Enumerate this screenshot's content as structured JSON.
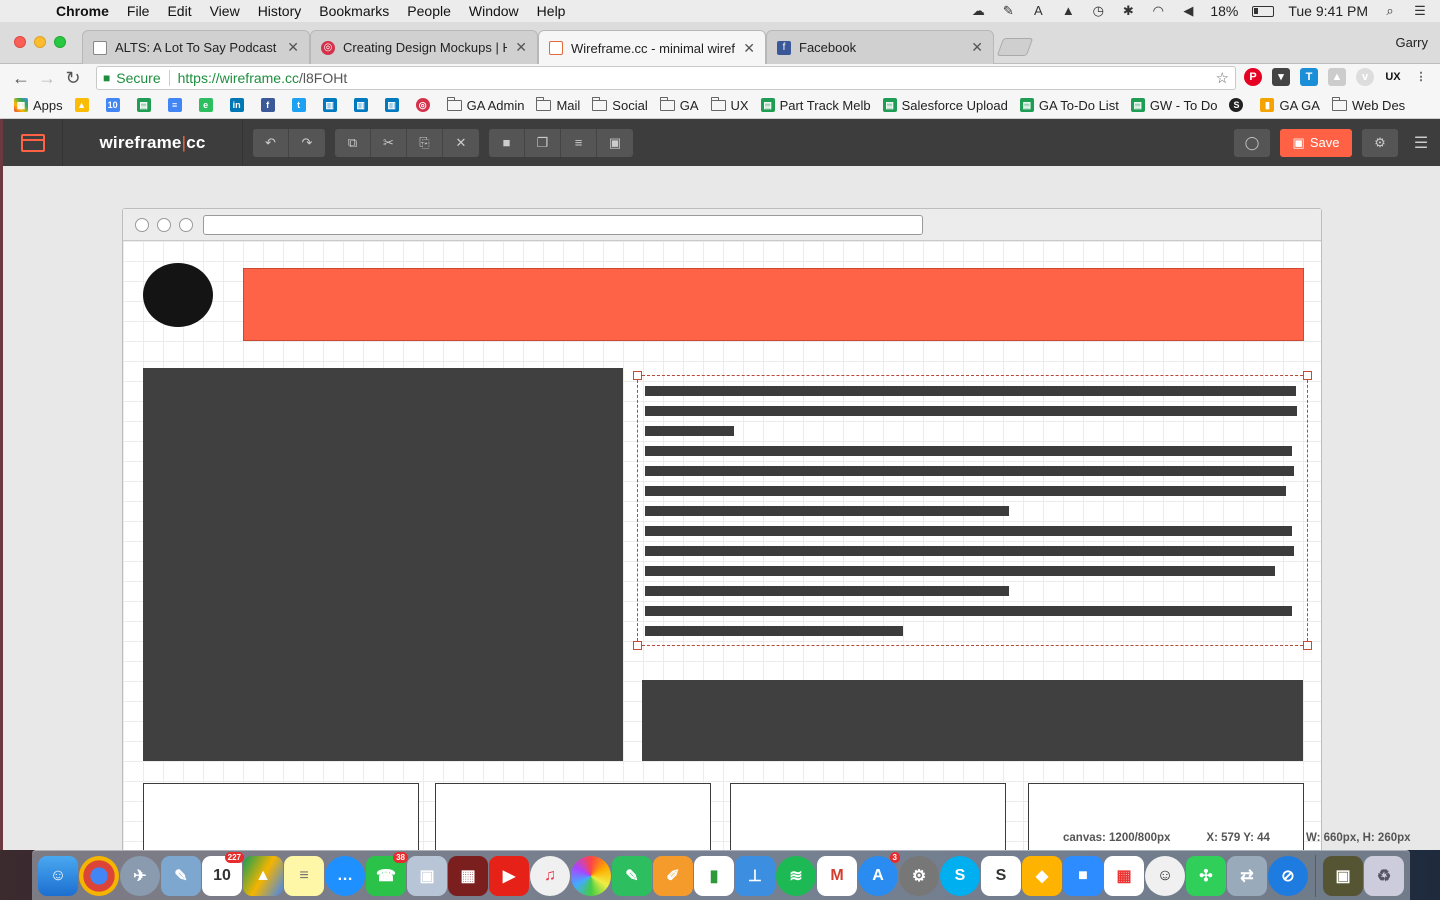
{
  "menubar": {
    "app": "Chrome",
    "items": [
      "File",
      "Edit",
      "View",
      "History",
      "Bookmarks",
      "People",
      "Window",
      "Help"
    ],
    "battery": "18%",
    "clock": "Tue 9:41 PM"
  },
  "tabs": [
    {
      "title": "ALTS: A Lot To Say Podcast",
      "icon": "document-icon"
    },
    {
      "title": "Creating Design Mockups | HT",
      "icon": "target-icon"
    },
    {
      "title": "Wireframe.cc - minimal wirefra",
      "icon": "wireframe-icon"
    },
    {
      "title": "Facebook",
      "icon": "facebook-icon"
    }
  ],
  "profile": "Garry",
  "address": {
    "secure_label": "Secure",
    "url_host": "https://wireframe.cc",
    "url_path": "/l8FOHt"
  },
  "bookmarks": [
    {
      "label": "Apps",
      "type": "apps"
    },
    {
      "label": "",
      "type": "drive"
    },
    {
      "label": "",
      "type": "calendar"
    },
    {
      "label": "",
      "type": "sheets"
    },
    {
      "label": "",
      "type": "docs"
    },
    {
      "label": "",
      "type": "evernote"
    },
    {
      "label": "",
      "type": "linkedin"
    },
    {
      "label": "",
      "type": "facebook"
    },
    {
      "label": "",
      "type": "twitter"
    },
    {
      "label": "",
      "type": "trello"
    },
    {
      "label": "",
      "type": "trello"
    },
    {
      "label": "",
      "type": "trello"
    },
    {
      "label": "",
      "type": "target"
    },
    {
      "label": "GA Admin",
      "type": "folder"
    },
    {
      "label": "Mail",
      "type": "folder"
    },
    {
      "label": "Social",
      "type": "folder"
    },
    {
      "label": "GA",
      "type": "folder"
    },
    {
      "label": "UX",
      "type": "folder"
    },
    {
      "label": "Part Track Melb",
      "type": "sheet"
    },
    {
      "label": "Salesforce Upload",
      "type": "sheet"
    },
    {
      "label": "GA To-Do List",
      "type": "sheet"
    },
    {
      "label": "GW - To Do",
      "type": "sheet"
    },
    {
      "label": "",
      "type": "s-circle"
    },
    {
      "label": "GA GA",
      "type": "analytics"
    },
    {
      "label": "Web Des",
      "type": "folder"
    }
  ],
  "app": {
    "name_left": "wireframe",
    "name_right": "cc",
    "save_label": "Save"
  },
  "status": {
    "canvas": "canvas: 1200/800px",
    "coords": "X: 579 Y: 44",
    "size": "W: 660px, H: 260px"
  },
  "dock": [
    "Finder",
    "Chrome",
    "Launchpad",
    "Preview",
    "Calendar",
    "Drive",
    "Notes",
    "Messages",
    "FaceTime",
    "Photo Booth",
    "Photo Browser",
    "YouTube",
    "iTunes",
    "Photos",
    "Evernote",
    "Pages",
    "Numbers",
    "Keynote",
    "Spotify",
    "Gmail",
    "App Store",
    "System Preferences",
    "Skype",
    "Slides",
    "Sketch",
    "Zoom",
    "Apps Grid",
    "Emoji",
    "Cluster",
    "Migration",
    "Safari",
    "Downloads",
    "Trash"
  ],
  "colors": {
    "accent": "#ff6144",
    "banner": "#ff6347",
    "dark_block": "#404040",
    "toolbar": "#3d3d3d"
  }
}
